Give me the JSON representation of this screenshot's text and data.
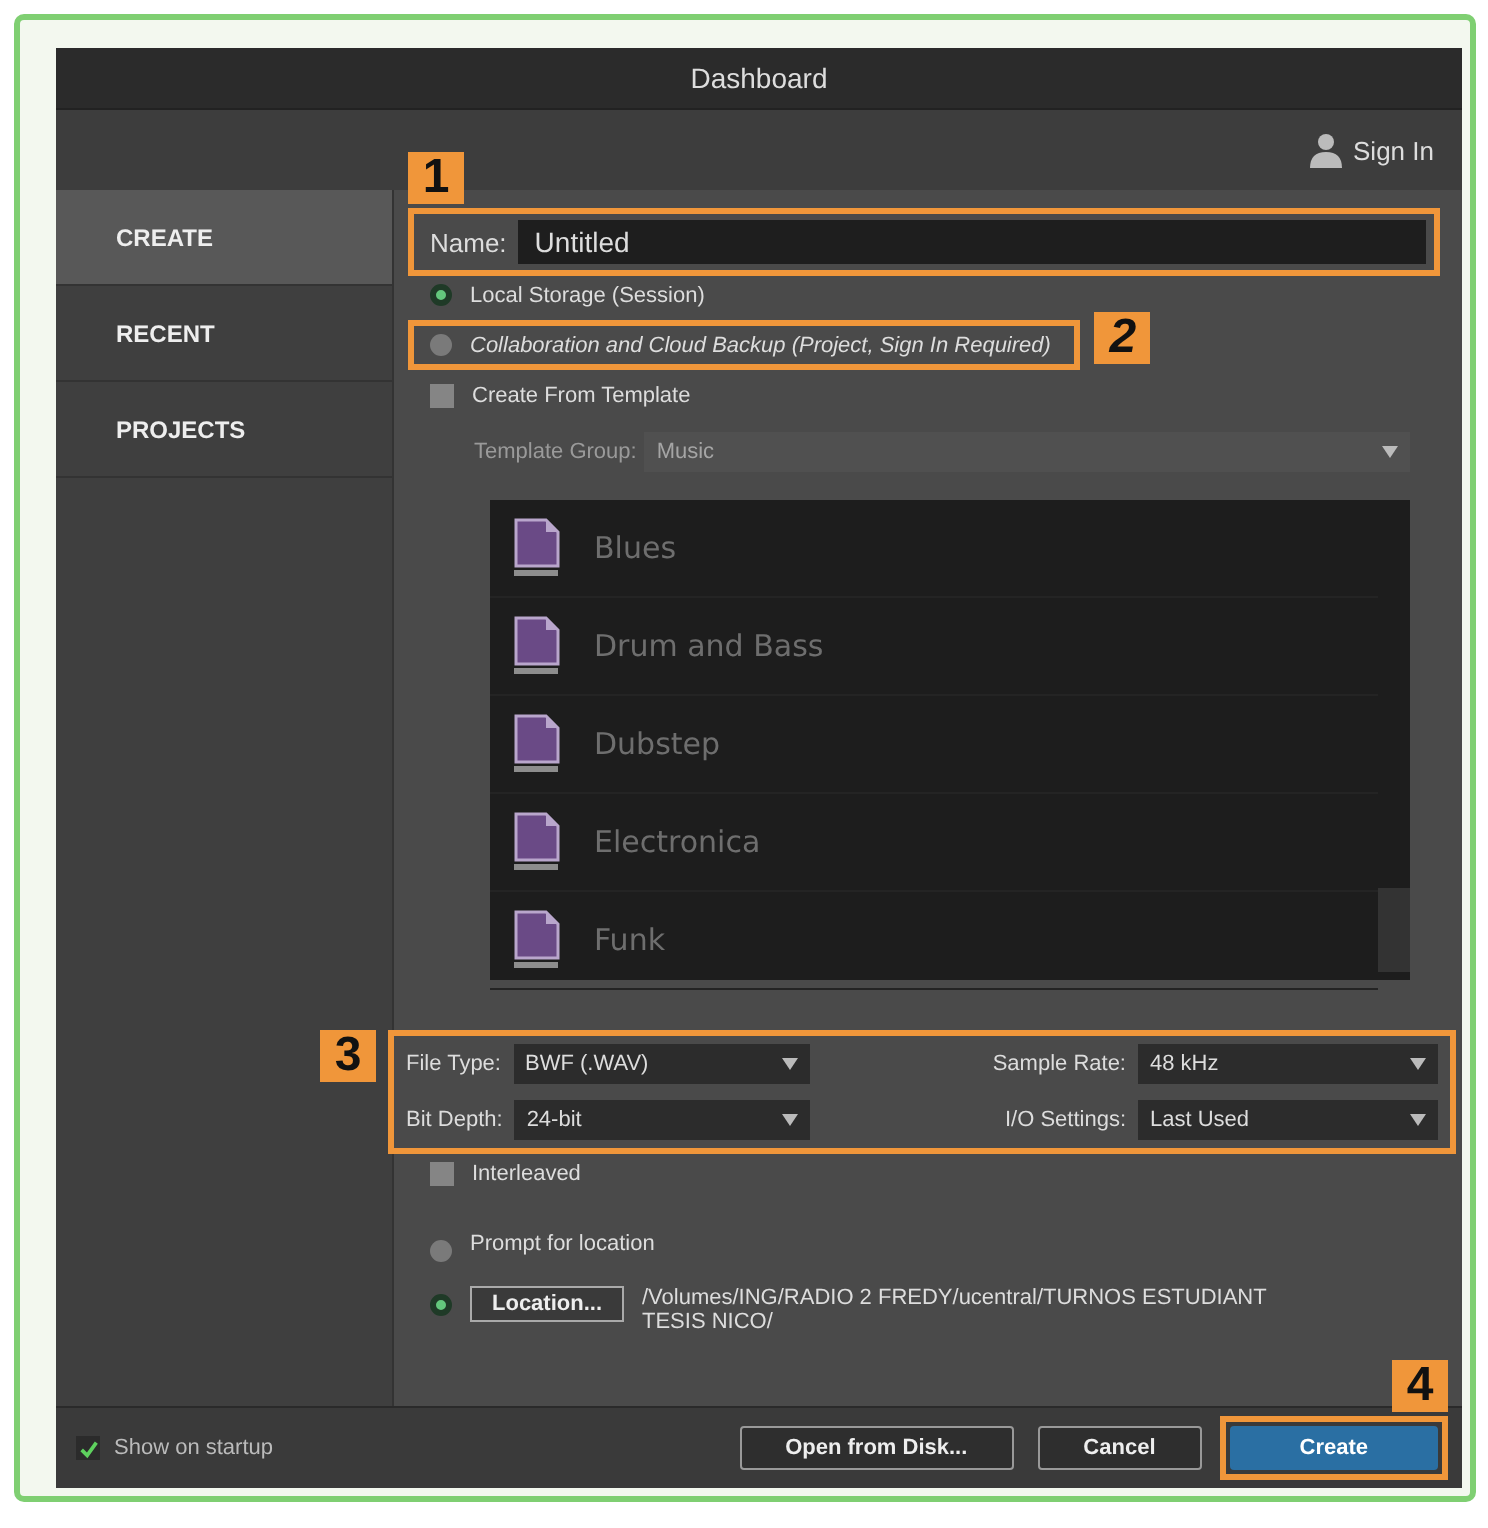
{
  "window": {
    "title": "Dashboard"
  },
  "sign_in": {
    "label": "Sign In"
  },
  "sidebar": {
    "items": [
      {
        "label": "CREATE",
        "selected": true
      },
      {
        "label": "RECENT",
        "selected": false
      },
      {
        "label": "PROJECTS",
        "selected": false
      }
    ]
  },
  "name_field": {
    "label": "Name:",
    "value": "Untitled",
    "callout": "1"
  },
  "storage_options": [
    {
      "label": "Local Storage (Session)",
      "selected": true
    },
    {
      "label": "Collaboration and Cloud Backup (Project, Sign In Required)",
      "selected": false,
      "callout": "2"
    }
  ],
  "create_from_template": {
    "label": "Create From Template",
    "checked": false
  },
  "template_group": {
    "label": "Template Group:",
    "value": "Music",
    "disabled": true
  },
  "templates": [
    {
      "name": "Blues"
    },
    {
      "name": "Drum and Bass"
    },
    {
      "name": "Dubstep"
    },
    {
      "name": "Electronica"
    },
    {
      "name": "Funk"
    }
  ],
  "session_settings": {
    "callout": "3",
    "fields": [
      {
        "label": "File Type:",
        "value": "BWF (.WAV)"
      },
      {
        "label": "Sample Rate:",
        "value": "48 kHz"
      },
      {
        "label": "Bit Depth:",
        "value": "24-bit"
      },
      {
        "label": "I/O Settings:",
        "value": "Last Used"
      }
    ]
  },
  "interleaved": {
    "label": "Interleaved",
    "checked": false
  },
  "location_options": [
    {
      "kind": "radio",
      "label": "Prompt for location",
      "selected": false
    },
    {
      "kind": "location",
      "button": "Location...",
      "path_lines": [
        "/Volumes/ING/RADIO 2 FREDY/ucentral/TURNOS ESTUDIANT",
        "TESIS NICO/"
      ],
      "selected": true
    }
  ],
  "footer": {
    "show_on_startup": {
      "label": "Show on startup",
      "checked": true
    },
    "buttons": [
      {
        "label": "Open from Disk...",
        "kind": "normal"
      },
      {
        "label": "Cancel",
        "kind": "normal"
      },
      {
        "label": "Create",
        "kind": "primary",
        "callout": "4"
      }
    ]
  }
}
